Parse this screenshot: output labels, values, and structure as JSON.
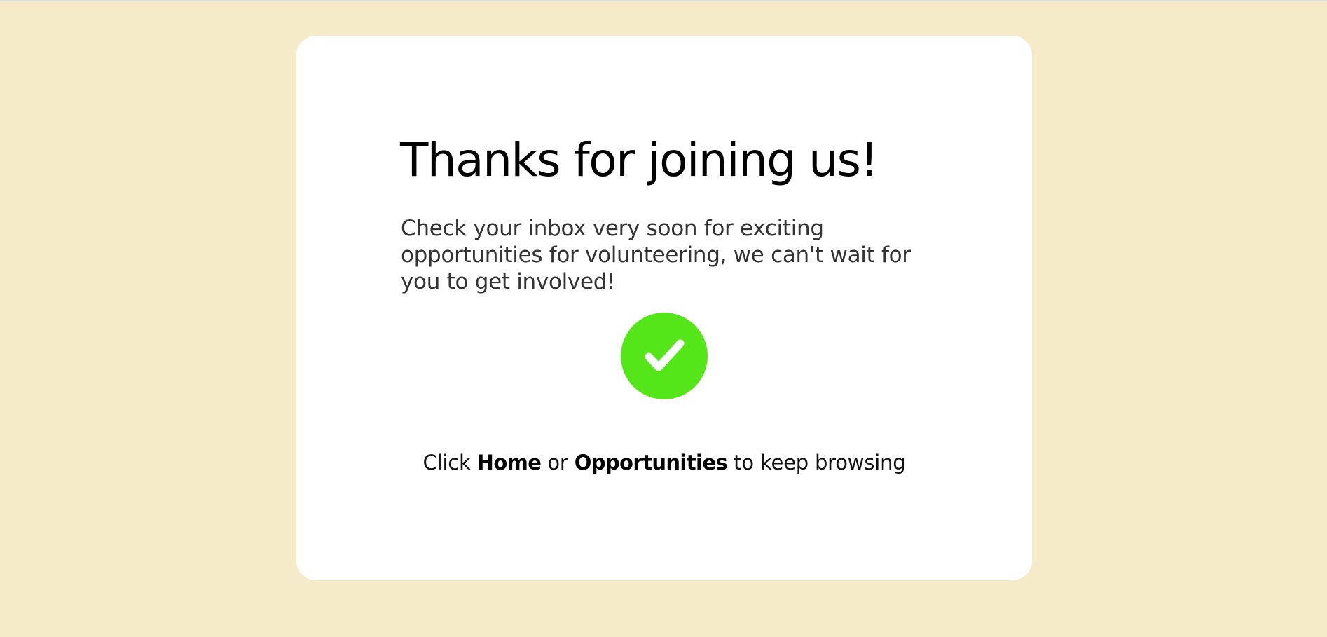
{
  "colors": {
    "page_background": "#f5ebc8",
    "card_background": "#ffffff",
    "success_green": "#55e61a"
  },
  "confirmation": {
    "title": "Thanks for joining us!",
    "message": "Check your inbox very soon for exciting opportunities for volunteering, we can't wait for you to get involved!",
    "icon": "check-circle-icon"
  },
  "browse_hint": {
    "prefix": "Click",
    "home_link": "Home",
    "connector": "or",
    "opportunities_link": "Opportunities",
    "suffix": "to keep browsing"
  }
}
